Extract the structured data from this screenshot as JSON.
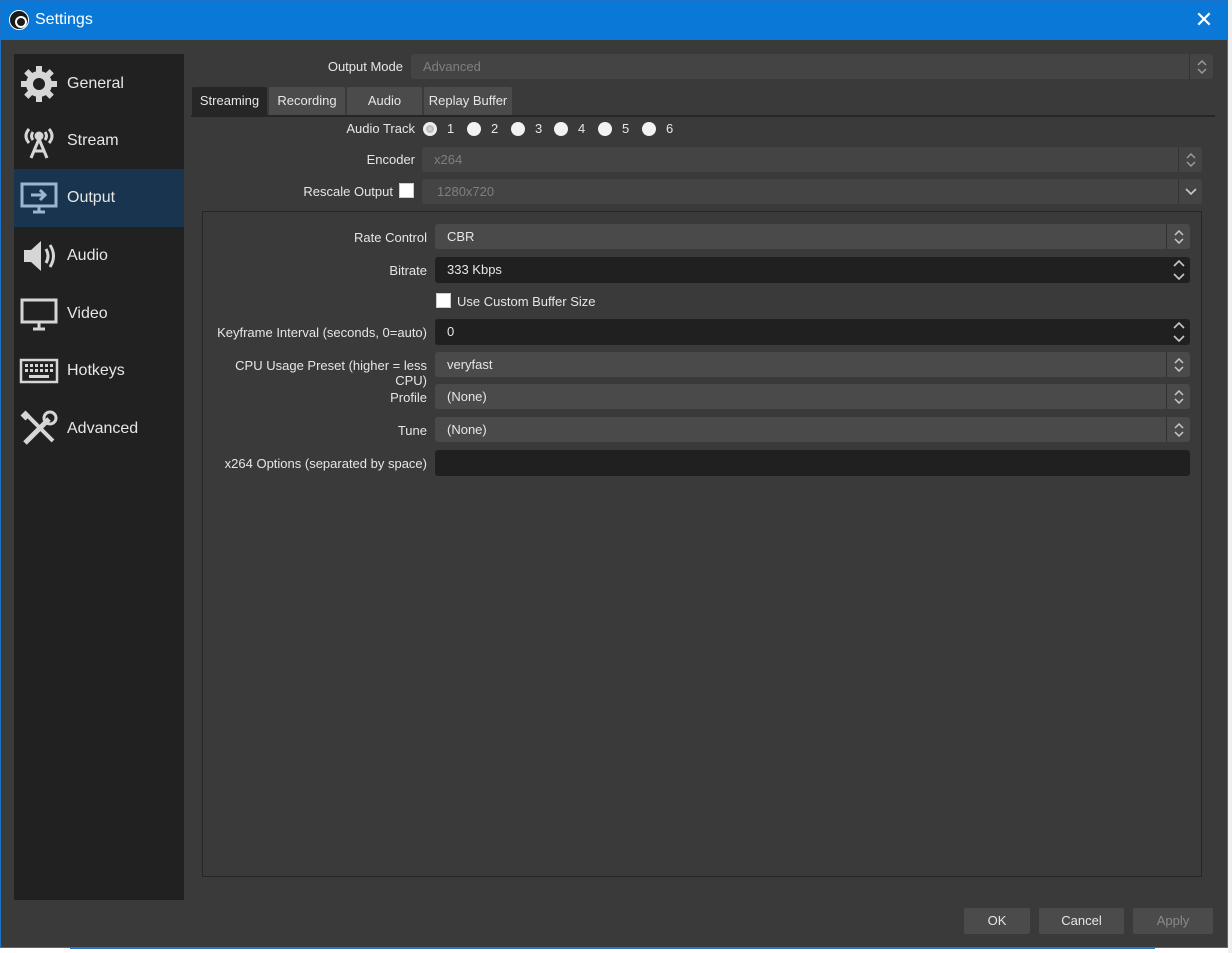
{
  "window": {
    "title": "Settings",
    "close_glyph": "✕"
  },
  "sidebar": {
    "items": [
      {
        "label": "General",
        "icon": "gear-icon"
      },
      {
        "label": "Stream",
        "icon": "antenna-icon"
      },
      {
        "label": "Output",
        "icon": "output-monitor-icon",
        "active": true
      },
      {
        "label": "Audio",
        "icon": "speaker-icon"
      },
      {
        "label": "Video",
        "icon": "monitor-icon"
      },
      {
        "label": "Hotkeys",
        "icon": "keyboard-icon"
      },
      {
        "label": "Advanced",
        "icon": "tools-icon"
      }
    ]
  },
  "output_mode": {
    "label": "Output Mode",
    "value": "Advanced"
  },
  "tabs": [
    {
      "label": "Streaming",
      "active": true
    },
    {
      "label": "Recording"
    },
    {
      "label": "Audio"
    },
    {
      "label": "Replay Buffer"
    }
  ],
  "audio_track": {
    "label": "Audio Track",
    "options": [
      "1",
      "2",
      "3",
      "4",
      "5",
      "6"
    ],
    "selected": "1"
  },
  "encoder": {
    "label": "Encoder",
    "value": "x264"
  },
  "rescale_output": {
    "label": "Rescale Output",
    "checked": false,
    "value": "1280x720"
  },
  "encoder_settings": {
    "rate_control": {
      "label": "Rate Control",
      "value": "CBR"
    },
    "bitrate": {
      "label": "Bitrate",
      "value": "333 Kbps"
    },
    "custom_buffer": {
      "label": "Use Custom Buffer Size",
      "checked": false
    },
    "keyframe": {
      "label": "Keyframe Interval (seconds, 0=auto)",
      "value": "0"
    },
    "cpu_preset": {
      "label": "CPU Usage Preset (higher = less CPU)",
      "value": "veryfast"
    },
    "profile": {
      "label": "Profile",
      "value": "(None)"
    },
    "tune": {
      "label": "Tune",
      "value": "(None)"
    },
    "x264_options": {
      "label": "x264 Options (separated by space)",
      "value": ""
    }
  },
  "footer": {
    "ok": "OK",
    "cancel": "Cancel",
    "apply": "Apply"
  },
  "colors": {
    "titlebar": "#0a78d7",
    "sidebar_active": "#19344f",
    "panel": "#3a3a3a"
  }
}
